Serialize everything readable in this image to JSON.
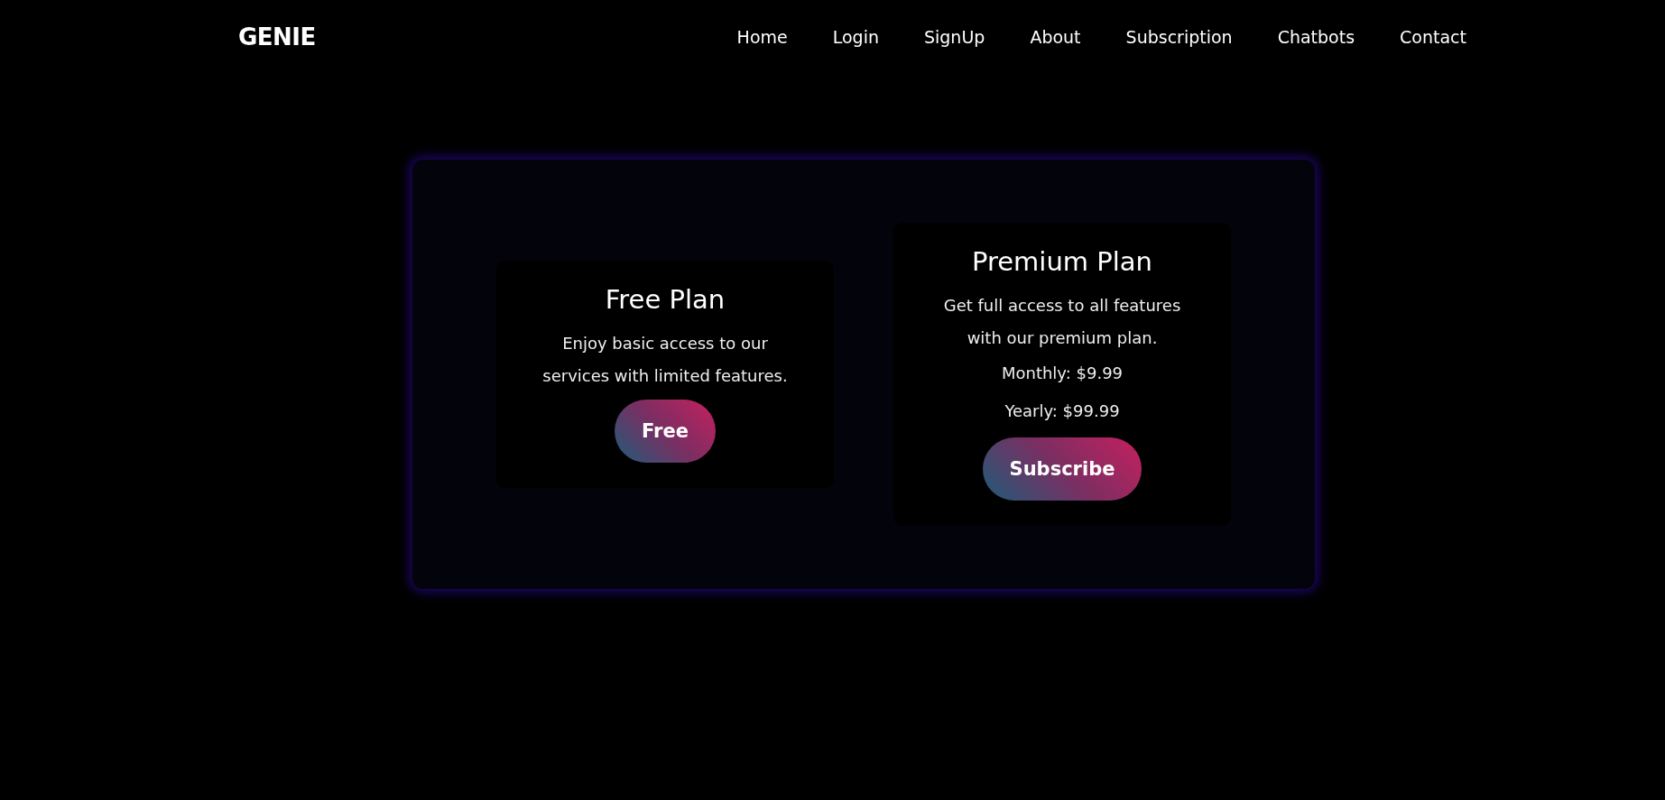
{
  "header": {
    "logo": "GENIE",
    "nav": [
      "Home",
      "Login",
      "SignUp",
      "About",
      "Subscription",
      "Chatbots",
      "Contact"
    ]
  },
  "plans": [
    {
      "title": "Free Plan",
      "description": "Enjoy basic access to our services with limited features.",
      "button": "Free"
    },
    {
      "title": "Premium Plan",
      "description": "Get full access to all features with our premium plan.",
      "prices": [
        "Monthly: $9.99",
        "Yearly: $99.99"
      ],
      "button": "Subscribe"
    }
  ]
}
